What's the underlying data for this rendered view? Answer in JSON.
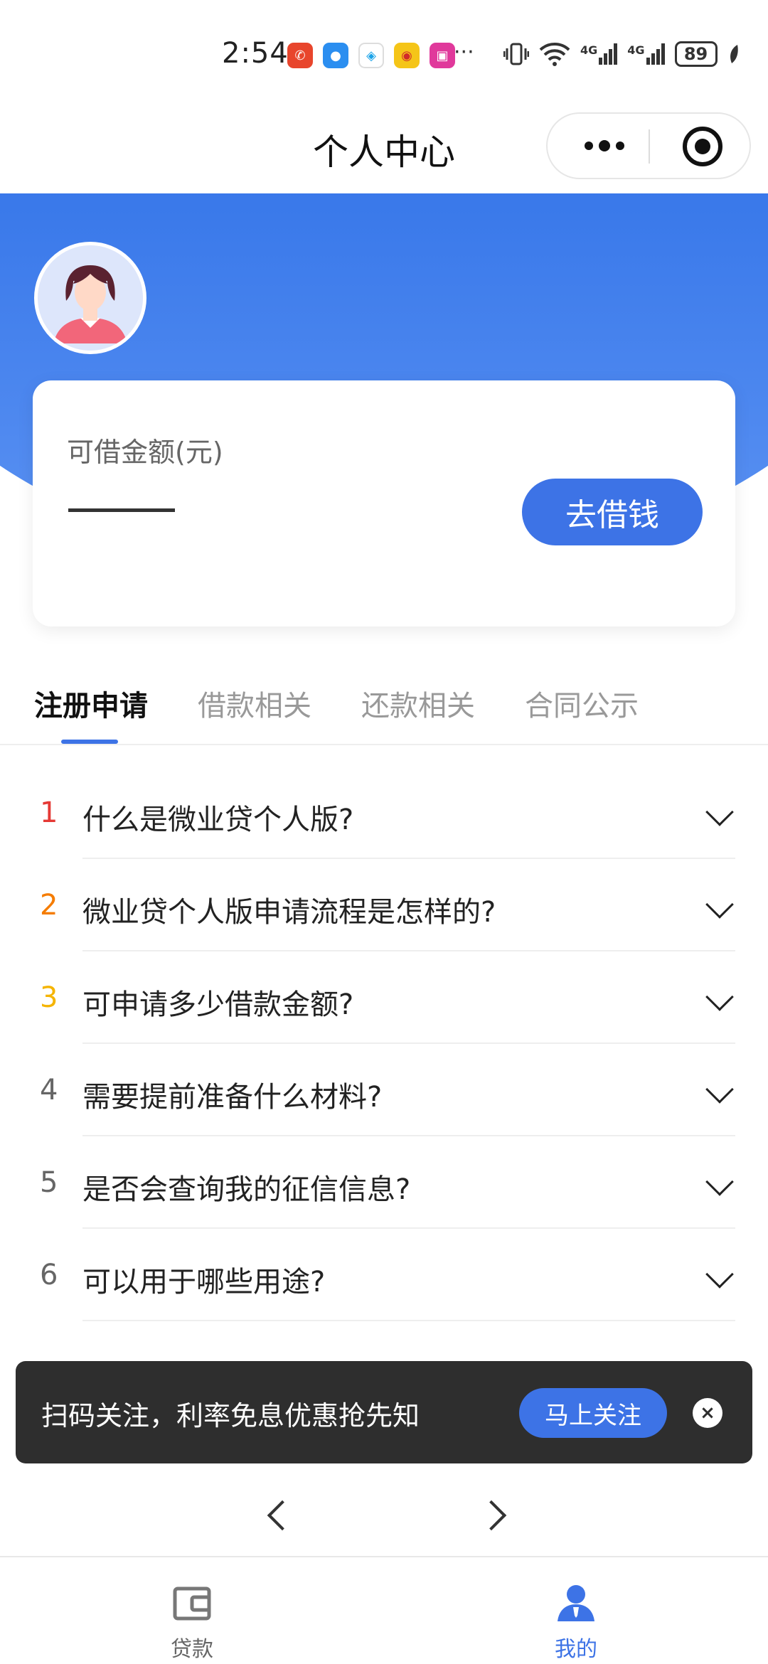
{
  "status_bar": {
    "time": "2:54",
    "more_dots": "···",
    "network_1": "4G",
    "network_2": "4G",
    "battery": "89"
  },
  "title_bar": {
    "title": "个人中心"
  },
  "credit_card": {
    "label": "可借金额(元)",
    "borrow_button": "去借钱"
  },
  "tabs": [
    {
      "label": "注册申请",
      "active": true
    },
    {
      "label": "借款相关",
      "active": false
    },
    {
      "label": "还款相关",
      "active": false
    },
    {
      "label": "合同公示",
      "active": false
    }
  ],
  "faq": [
    {
      "num": "1",
      "question": "什么是微业贷个人版?",
      "num_color": "#e53935"
    },
    {
      "num": "2",
      "question": "微业贷个人版申请流程是怎样的?",
      "num_color": "#f57c00"
    },
    {
      "num": "3",
      "question": "可申请多少借款金额?",
      "num_color": "#f5b400"
    },
    {
      "num": "4",
      "question": "需要提前准备什么材料?",
      "num_color": "#666666"
    },
    {
      "num": "5",
      "question": "是否会查询我的征信信息?",
      "num_color": "#666666"
    },
    {
      "num": "6",
      "question": "可以用于哪些用途?",
      "num_color": "#666666"
    }
  ],
  "banner": {
    "text": "扫码关注，利率免息优惠抢先知",
    "button": "马上关注",
    "close": "×"
  },
  "tabbar": [
    {
      "label": "贷款",
      "icon": "wallet-icon",
      "active": false
    },
    {
      "label": "我的",
      "icon": "user-icon",
      "active": true
    }
  ],
  "colors": {
    "primary": "#3d73e6",
    "banner_bg": "#2e2e2e"
  }
}
